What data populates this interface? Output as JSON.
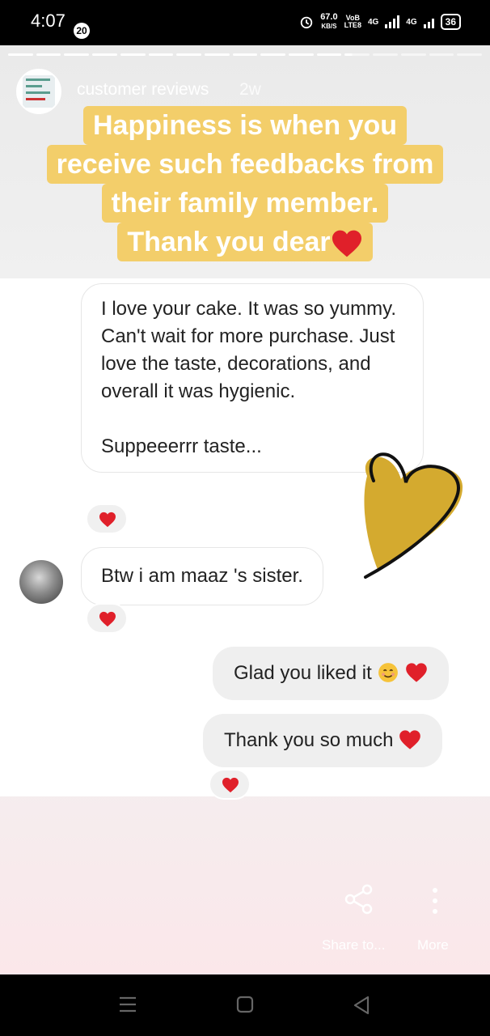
{
  "status_bar": {
    "time": "4:07",
    "notification_count": "20",
    "net_speed": "67.0",
    "net_speed_unit": "KB/S",
    "volte_top": "VoB",
    "volte_bottom": "LTE8",
    "network_1": "4G",
    "network_2": "4G",
    "battery": "36"
  },
  "story": {
    "author": "customer reviews",
    "age": "2w",
    "progress": {
      "segments": 17,
      "completed": 12,
      "current_fraction": 0.3
    },
    "caption_lines": [
      "Happiness is when you",
      "receive such feedbacks from",
      "their family member.",
      "Thank you dear"
    ]
  },
  "chat": {
    "incoming_message_1": "I love your cake.  It was so yummy.  Can't wait for more purchase.  Just love the taste, decorations,  and overall it was hygienic.\n\nSuppeeerrr taste...",
    "incoming_message_2": "Btw i am maaz 's sister.",
    "outgoing_message_1": "Glad you liked it",
    "outgoing_message_2": "Thank you so much"
  },
  "actions": {
    "share_label": "Share to...",
    "more_label": "More"
  },
  "colors": {
    "caption_highlight": "#f3ce6a",
    "heart_red": "#e0202a",
    "sticker_gold": "#d4aa2f"
  },
  "icons": [
    "alarm-icon",
    "share-icon",
    "more-icon",
    "recents-icon",
    "home-icon",
    "back-icon",
    "heart-icon",
    "smile-icon"
  ]
}
